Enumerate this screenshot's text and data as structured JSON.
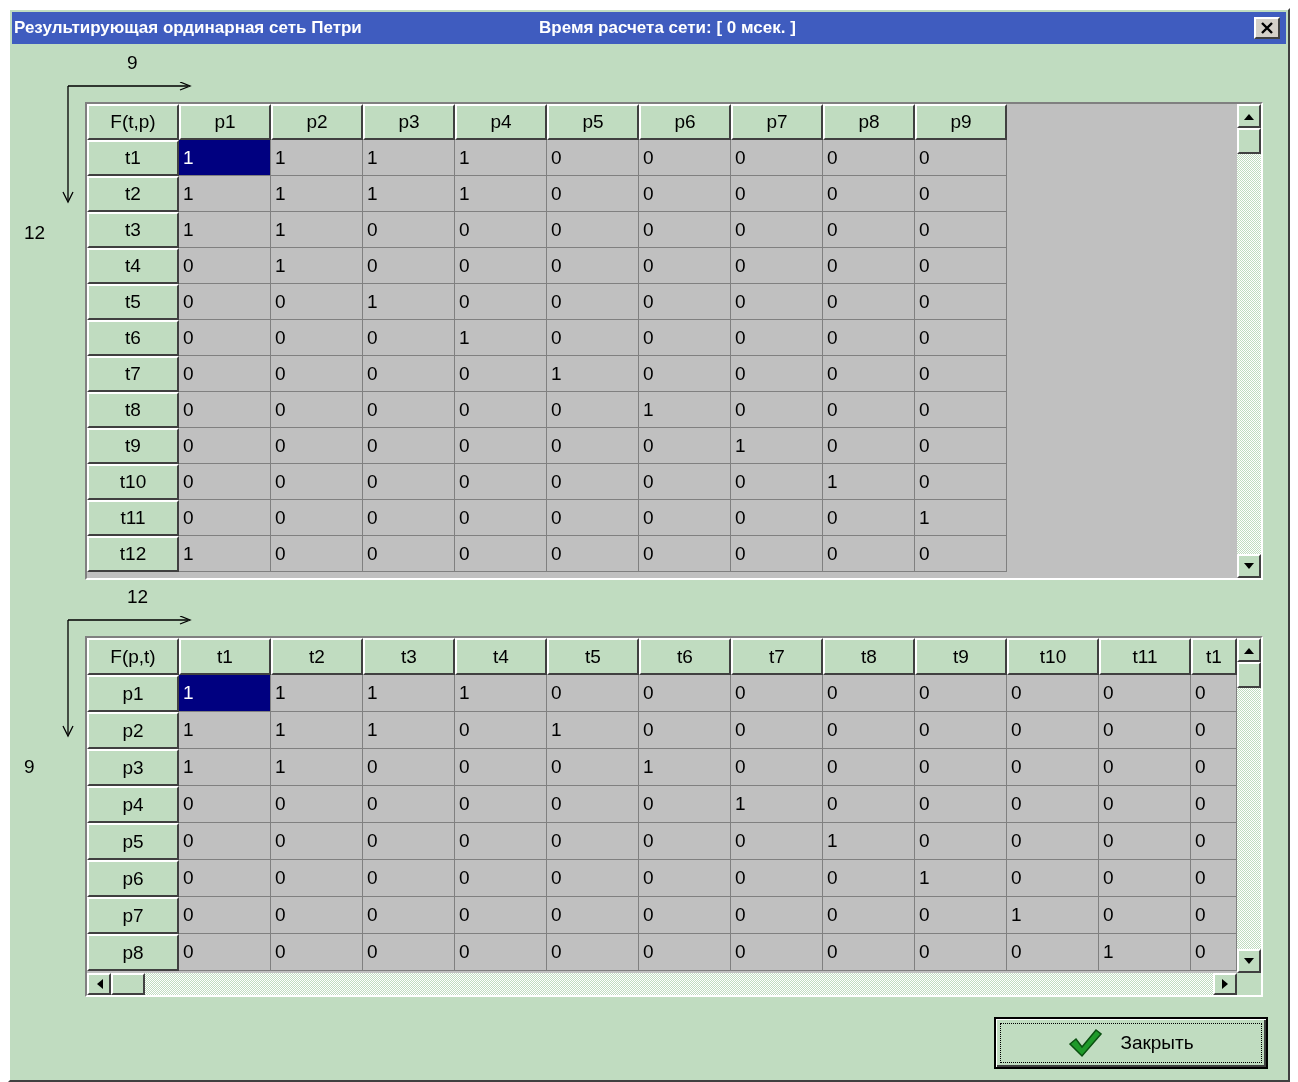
{
  "window": {
    "title": "Результирующая ординарная сеть Петри",
    "calc_time": "Время расчета сети: [ 0 мсек. ]"
  },
  "grids": [
    {
      "corner": "F(t,p)",
      "column_count": "9",
      "row_count": "12",
      "horizontal_scrollbar": false,
      "columns": [
        "p1",
        "p2",
        "p3",
        "p4",
        "p5",
        "p6",
        "p7",
        "p8",
        "p9"
      ],
      "rows": [
        {
          "label": "t1",
          "cells": [
            {
              "text": "1",
              "selected": true
            },
            {
              "text": "1",
              "selected": false
            },
            {
              "text": "1",
              "selected": false
            },
            {
              "text": "1",
              "selected": false
            },
            {
              "text": "0",
              "selected": false
            },
            {
              "text": "0",
              "selected": false
            },
            {
              "text": "0",
              "selected": false
            },
            {
              "text": "0",
              "selected": false
            },
            {
              "text": "0",
              "selected": false
            }
          ]
        },
        {
          "label": "t2",
          "cells": [
            {
              "text": "1",
              "selected": false
            },
            {
              "text": "1",
              "selected": false
            },
            {
              "text": "1",
              "selected": false
            },
            {
              "text": "1",
              "selected": false
            },
            {
              "text": "0",
              "selected": false
            },
            {
              "text": "0",
              "selected": false
            },
            {
              "text": "0",
              "selected": false
            },
            {
              "text": "0",
              "selected": false
            },
            {
              "text": "0",
              "selected": false
            }
          ]
        },
        {
          "label": "t3",
          "cells": [
            {
              "text": "1",
              "selected": false
            },
            {
              "text": "1",
              "selected": false
            },
            {
              "text": "0",
              "selected": false
            },
            {
              "text": "0",
              "selected": false
            },
            {
              "text": "0",
              "selected": false
            },
            {
              "text": "0",
              "selected": false
            },
            {
              "text": "0",
              "selected": false
            },
            {
              "text": "0",
              "selected": false
            },
            {
              "text": "0",
              "selected": false
            }
          ]
        },
        {
          "label": "t4",
          "cells": [
            {
              "text": "0",
              "selected": false
            },
            {
              "text": "1",
              "selected": false
            },
            {
              "text": "0",
              "selected": false
            },
            {
              "text": "0",
              "selected": false
            },
            {
              "text": "0",
              "selected": false
            },
            {
              "text": "0",
              "selected": false
            },
            {
              "text": "0",
              "selected": false
            },
            {
              "text": "0",
              "selected": false
            },
            {
              "text": "0",
              "selected": false
            }
          ]
        },
        {
          "label": "t5",
          "cells": [
            {
              "text": "0",
              "selected": false
            },
            {
              "text": "0",
              "selected": false
            },
            {
              "text": "1",
              "selected": false
            },
            {
              "text": "0",
              "selected": false
            },
            {
              "text": "0",
              "selected": false
            },
            {
              "text": "0",
              "selected": false
            },
            {
              "text": "0",
              "selected": false
            },
            {
              "text": "0",
              "selected": false
            },
            {
              "text": "0",
              "selected": false
            }
          ]
        },
        {
          "label": "t6",
          "cells": [
            {
              "text": "0",
              "selected": false
            },
            {
              "text": "0",
              "selected": false
            },
            {
              "text": "0",
              "selected": false
            },
            {
              "text": "1",
              "selected": false
            },
            {
              "text": "0",
              "selected": false
            },
            {
              "text": "0",
              "selected": false
            },
            {
              "text": "0",
              "selected": false
            },
            {
              "text": "0",
              "selected": false
            },
            {
              "text": "0",
              "selected": false
            }
          ]
        },
        {
          "label": "t7",
          "cells": [
            {
              "text": "0",
              "selected": false
            },
            {
              "text": "0",
              "selected": false
            },
            {
              "text": "0",
              "selected": false
            },
            {
              "text": "0",
              "selected": false
            },
            {
              "text": "1",
              "selected": false
            },
            {
              "text": "0",
              "selected": false
            },
            {
              "text": "0",
              "selected": false
            },
            {
              "text": "0",
              "selected": false
            },
            {
              "text": "0",
              "selected": false
            }
          ]
        },
        {
          "label": "t8",
          "cells": [
            {
              "text": "0",
              "selected": false
            },
            {
              "text": "0",
              "selected": false
            },
            {
              "text": "0",
              "selected": false
            },
            {
              "text": "0",
              "selected": false
            },
            {
              "text": "0",
              "selected": false
            },
            {
              "text": "1",
              "selected": false
            },
            {
              "text": "0",
              "selected": false
            },
            {
              "text": "0",
              "selected": false
            },
            {
              "text": "0",
              "selected": false
            }
          ]
        },
        {
          "label": "t9",
          "cells": [
            {
              "text": "0",
              "selected": false
            },
            {
              "text": "0",
              "selected": false
            },
            {
              "text": "0",
              "selected": false
            },
            {
              "text": "0",
              "selected": false
            },
            {
              "text": "0",
              "selected": false
            },
            {
              "text": "0",
              "selected": false
            },
            {
              "text": "1",
              "selected": false
            },
            {
              "text": "0",
              "selected": false
            },
            {
              "text": "0",
              "selected": false
            }
          ]
        },
        {
          "label": "t10",
          "cells": [
            {
              "text": "0",
              "selected": false
            },
            {
              "text": "0",
              "selected": false
            },
            {
              "text": "0",
              "selected": false
            },
            {
              "text": "0",
              "selected": false
            },
            {
              "text": "0",
              "selected": false
            },
            {
              "text": "0",
              "selected": false
            },
            {
              "text": "0",
              "selected": false
            },
            {
              "text": "1",
              "selected": false
            },
            {
              "text": "0",
              "selected": false
            }
          ]
        },
        {
          "label": "t11",
          "cells": [
            {
              "text": "0",
              "selected": false
            },
            {
              "text": "0",
              "selected": false
            },
            {
              "text": "0",
              "selected": false
            },
            {
              "text": "0",
              "selected": false
            },
            {
              "text": "0",
              "selected": false
            },
            {
              "text": "0",
              "selected": false
            },
            {
              "text": "0",
              "selected": false
            },
            {
              "text": "0",
              "selected": false
            },
            {
              "text": "1",
              "selected": false
            }
          ]
        },
        {
          "label": "t12",
          "cells": [
            {
              "text": "1",
              "selected": false
            },
            {
              "text": "0",
              "selected": false
            },
            {
              "text": "0",
              "selected": false
            },
            {
              "text": "0",
              "selected": false
            },
            {
              "text": "0",
              "selected": false
            },
            {
              "text": "0",
              "selected": false
            },
            {
              "text": "0",
              "selected": false
            },
            {
              "text": "0",
              "selected": false
            },
            {
              "text": "0",
              "selected": false
            }
          ]
        }
      ]
    },
    {
      "corner": "F(p,t)",
      "column_count": "12",
      "row_count": "9",
      "horizontal_scrollbar": true,
      "columns": [
        "t1",
        "t2",
        "t3",
        "t4",
        "t5",
        "t6",
        "t7",
        "t8",
        "t9",
        "t10",
        "t11",
        "t1"
      ],
      "rows": [
        {
          "label": "p1",
          "cells": [
            {
              "text": "1",
              "selected": true
            },
            {
              "text": "1",
              "selected": false
            },
            {
              "text": "1",
              "selected": false
            },
            {
              "text": "1",
              "selected": false
            },
            {
              "text": "0",
              "selected": false
            },
            {
              "text": "0",
              "selected": false
            },
            {
              "text": "0",
              "selected": false
            },
            {
              "text": "0",
              "selected": false
            },
            {
              "text": "0",
              "selected": false
            },
            {
              "text": "0",
              "selected": false
            },
            {
              "text": "0",
              "selected": false
            },
            {
              "text": "0",
              "selected": false
            }
          ]
        },
        {
          "label": "p2",
          "cells": [
            {
              "text": "1",
              "selected": false
            },
            {
              "text": "1",
              "selected": false
            },
            {
              "text": "1",
              "selected": false
            },
            {
              "text": "0",
              "selected": false
            },
            {
              "text": "1",
              "selected": false
            },
            {
              "text": "0",
              "selected": false
            },
            {
              "text": "0",
              "selected": false
            },
            {
              "text": "0",
              "selected": false
            },
            {
              "text": "0",
              "selected": false
            },
            {
              "text": "0",
              "selected": false
            },
            {
              "text": "0",
              "selected": false
            },
            {
              "text": "0",
              "selected": false
            }
          ]
        },
        {
          "label": "p3",
          "cells": [
            {
              "text": "1",
              "selected": false
            },
            {
              "text": "1",
              "selected": false
            },
            {
              "text": "0",
              "selected": false
            },
            {
              "text": "0",
              "selected": false
            },
            {
              "text": "0",
              "selected": false
            },
            {
              "text": "1",
              "selected": false
            },
            {
              "text": "0",
              "selected": false
            },
            {
              "text": "0",
              "selected": false
            },
            {
              "text": "0",
              "selected": false
            },
            {
              "text": "0",
              "selected": false
            },
            {
              "text": "0",
              "selected": false
            },
            {
              "text": "0",
              "selected": false
            }
          ]
        },
        {
          "label": "p4",
          "cells": [
            {
              "text": "0",
              "selected": false
            },
            {
              "text": "0",
              "selected": false
            },
            {
              "text": "0",
              "selected": false
            },
            {
              "text": "0",
              "selected": false
            },
            {
              "text": "0",
              "selected": false
            },
            {
              "text": "0",
              "selected": false
            },
            {
              "text": "1",
              "selected": false
            },
            {
              "text": "0",
              "selected": false
            },
            {
              "text": "0",
              "selected": false
            },
            {
              "text": "0",
              "selected": false
            },
            {
              "text": "0",
              "selected": false
            },
            {
              "text": "0",
              "selected": false
            }
          ]
        },
        {
          "label": "p5",
          "cells": [
            {
              "text": "0",
              "selected": false
            },
            {
              "text": "0",
              "selected": false
            },
            {
              "text": "0",
              "selected": false
            },
            {
              "text": "0",
              "selected": false
            },
            {
              "text": "0",
              "selected": false
            },
            {
              "text": "0",
              "selected": false
            },
            {
              "text": "0",
              "selected": false
            },
            {
              "text": "1",
              "selected": false
            },
            {
              "text": "0",
              "selected": false
            },
            {
              "text": "0",
              "selected": false
            },
            {
              "text": "0",
              "selected": false
            },
            {
              "text": "0",
              "selected": false
            }
          ]
        },
        {
          "label": "p6",
          "cells": [
            {
              "text": "0",
              "selected": false
            },
            {
              "text": "0",
              "selected": false
            },
            {
              "text": "0",
              "selected": false
            },
            {
              "text": "0",
              "selected": false
            },
            {
              "text": "0",
              "selected": false
            },
            {
              "text": "0",
              "selected": false
            },
            {
              "text": "0",
              "selected": false
            },
            {
              "text": "0",
              "selected": false
            },
            {
              "text": "1",
              "selected": false
            },
            {
              "text": "0",
              "selected": false
            },
            {
              "text": "0",
              "selected": false
            },
            {
              "text": "0",
              "selected": false
            }
          ]
        },
        {
          "label": "p7",
          "cells": [
            {
              "text": "0",
              "selected": false
            },
            {
              "text": "0",
              "selected": false
            },
            {
              "text": "0",
              "selected": false
            },
            {
              "text": "0",
              "selected": false
            },
            {
              "text": "0",
              "selected": false
            },
            {
              "text": "0",
              "selected": false
            },
            {
              "text": "0",
              "selected": false
            },
            {
              "text": "0",
              "selected": false
            },
            {
              "text": "0",
              "selected": false
            },
            {
              "text": "1",
              "selected": false
            },
            {
              "text": "0",
              "selected": false
            },
            {
              "text": "0",
              "selected": false
            }
          ]
        },
        {
          "label": "p8",
          "cells": [
            {
              "text": "0",
              "selected": false
            },
            {
              "text": "0",
              "selected": false
            },
            {
              "text": "0",
              "selected": false
            },
            {
              "text": "0",
              "selected": false
            },
            {
              "text": "0",
              "selected": false
            },
            {
              "text": "0",
              "selected": false
            },
            {
              "text": "0",
              "selected": false
            },
            {
              "text": "0",
              "selected": false
            },
            {
              "text": "0",
              "selected": false
            },
            {
              "text": "0",
              "selected": false
            },
            {
              "text": "1",
              "selected": false
            },
            {
              "text": "0",
              "selected": false
            }
          ]
        }
      ]
    }
  ],
  "close_button": {
    "label": "Закрыть"
  }
}
